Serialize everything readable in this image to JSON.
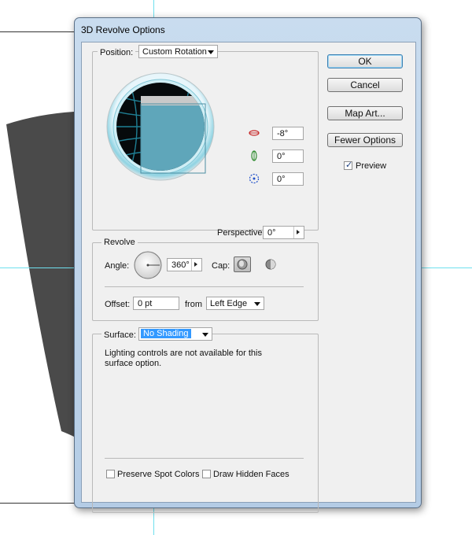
{
  "dialog": {
    "title": "3D Revolve Options",
    "position": {
      "legend": "Position:",
      "value": "Custom Rotation",
      "rot_x": "-8°",
      "rot_y": "0°",
      "rot_z": "0°",
      "perspective_label": "Perspective:",
      "perspective_value": "0°"
    },
    "revolve": {
      "legend": "Revolve",
      "angle_label": "Angle:",
      "angle_value": "360°",
      "cap_label": "Cap:",
      "offset_label": "Offset:",
      "offset_value": "0 pt",
      "from_label": "from",
      "from_value": "Left Edge"
    },
    "surface": {
      "legend": "Surface:",
      "value": "No Shading",
      "message": "Lighting controls are not available for this surface option.",
      "preserve_spot_colors": "Preserve Spot Colors",
      "draw_hidden_faces": "Draw Hidden Faces"
    },
    "buttons": {
      "ok": "OK",
      "cancel": "Cancel",
      "map_art": "Map Art...",
      "fewer_options": "Fewer Options"
    },
    "preview": {
      "label": "Preview",
      "checked": true
    }
  },
  "colors": {
    "dialog_frame": "#c9dcef",
    "client_bg": "#f0f0f0",
    "sphere_rim": "#9cd9e4",
    "cube_face": "#5fa6ba",
    "grid_line": "#1f7f94",
    "highlight": "#3399ff",
    "guide": "#6fe0ee",
    "shape_fill": "#4a4a4a"
  }
}
